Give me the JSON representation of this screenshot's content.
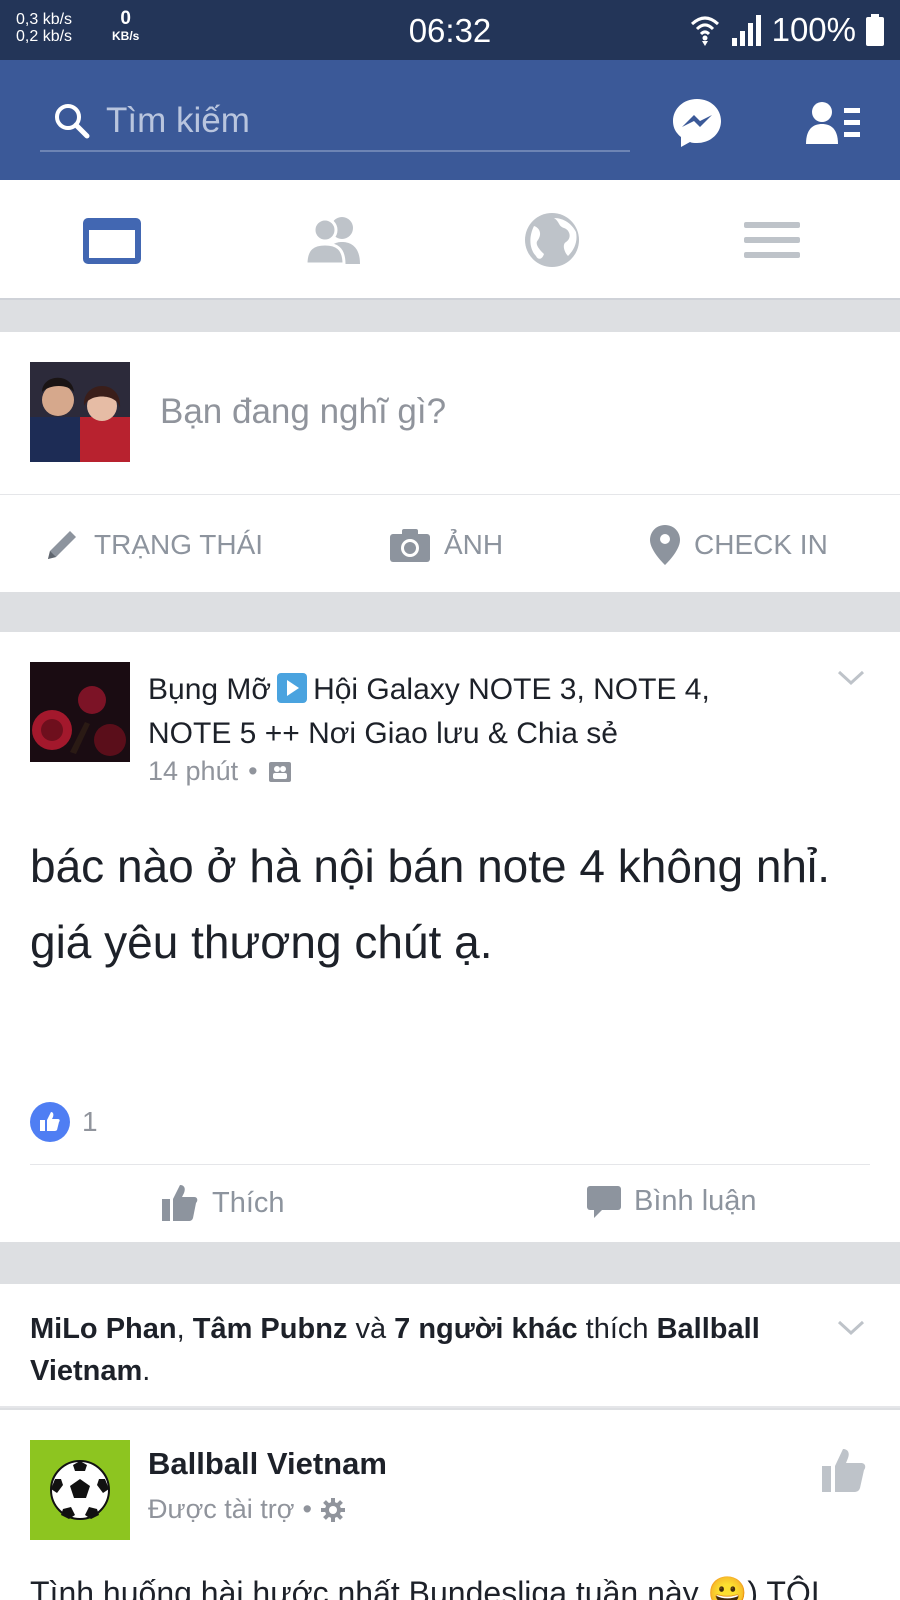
{
  "status_bar": {
    "up_speed": "0,3 kb/s",
    "down_speed": "0,2 kb/s",
    "kbs_value": "0",
    "kbs_unit": "KB/s",
    "time": "06:32",
    "battery": "100%"
  },
  "header": {
    "search_placeholder": "Tìm kiếm",
    "bg_color": "#3b5998"
  },
  "tabs": [
    {
      "icon": "news-feed-icon",
      "active": true
    },
    {
      "icon": "friends-icon",
      "active": false
    },
    {
      "icon": "globe-icon",
      "active": false
    },
    {
      "icon": "menu-icon",
      "active": false
    }
  ],
  "composer": {
    "prompt": "Bạn đang nghĩ gì?",
    "actions": {
      "status": "TRẠNG THÁI",
      "photo": "ẢNH",
      "checkin": "CHECK IN"
    }
  },
  "post": {
    "author": "Bụng Mỡ",
    "group": "Hội Galaxy NOTE 3, NOTE 4, NOTE 5 ++ Nơi Giao lưu & Chia sẻ",
    "time": "14 phút",
    "separator": "•",
    "body": "bác nào ở hà nội bán note 4 không nhỉ. giá yêu thương chút ạ.",
    "like_count": "1",
    "actions": {
      "like": "Thích",
      "comment": "Bình luận"
    }
  },
  "social_context": {
    "name1": "MiLo Phan",
    "sep1": ", ",
    "name2": "Tâm Pubnz",
    "and": " và ",
    "others": "7 người khác",
    "liked": " thích ",
    "page": "Ballball Vietnam",
    "end": "."
  },
  "sponsored": {
    "page_name": "Ballball Vietnam",
    "label": "Được tài trợ",
    "separator": "•",
    "body_preview": "Tình huống hài hước nhất Bundesliga tuần này 😀) TÔI"
  },
  "colors": {
    "brand": "#3b5998",
    "muted": "#90949c",
    "like_blue": "#4f7ef3"
  }
}
